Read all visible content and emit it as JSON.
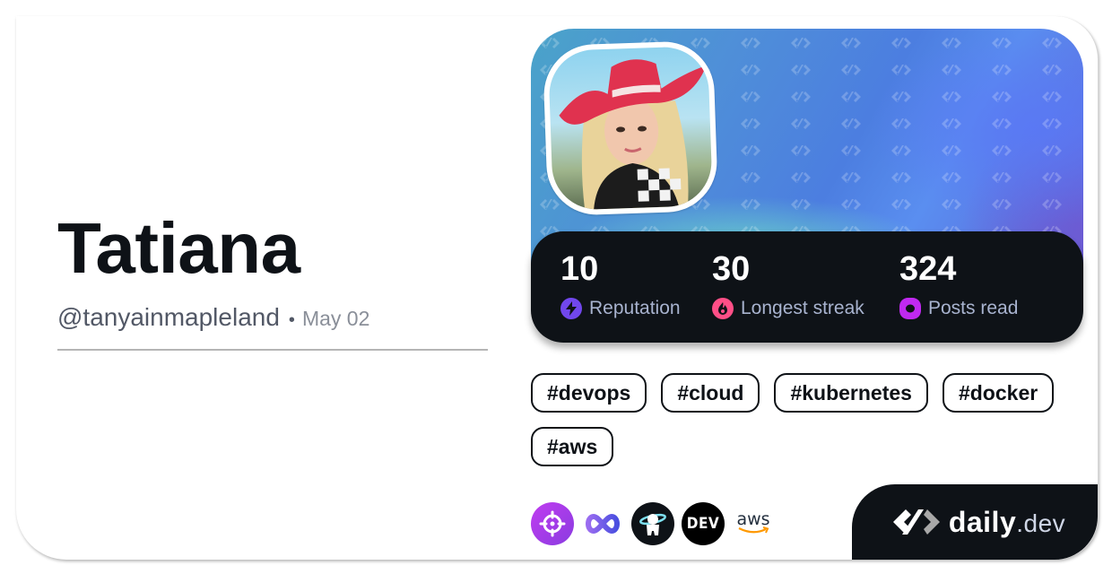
{
  "profile": {
    "name": "Tatiana",
    "handle": "@tanyainmapleland",
    "separator": "•",
    "joined": "May 02"
  },
  "stats": [
    {
      "value": "10",
      "label": "Reputation",
      "icon": "lightning-icon",
      "color": "#7147ed"
    },
    {
      "value": "30",
      "label": "Longest streak",
      "icon": "flame-icon",
      "color": "#ff4f87"
    },
    {
      "value": "324",
      "label": "Posts read",
      "icon": "eye-icon",
      "color": "#c029f0"
    }
  ],
  "tags": [
    "#devops",
    "#cloud",
    "#kubernetes",
    "#docker",
    "#aws"
  ],
  "badges": [
    {
      "name": "crosshair-source-badge",
      "color": "#a33ce0"
    },
    {
      "name": "infinity-source-badge",
      "color": "#6b5cf0"
    },
    {
      "name": "astronaut-source-badge",
      "color": "#0e1217"
    },
    {
      "name": "dev-source-badge",
      "color": "#000000",
      "text": "DEV"
    },
    {
      "name": "aws-source-badge",
      "text": "aws",
      "color": "#ff9900"
    }
  ],
  "brand": {
    "name": "daily",
    "tld": ".dev"
  },
  "colors": {
    "ink": "#0e1217",
    "muted": "#525866",
    "label": "#a8b3cf"
  }
}
